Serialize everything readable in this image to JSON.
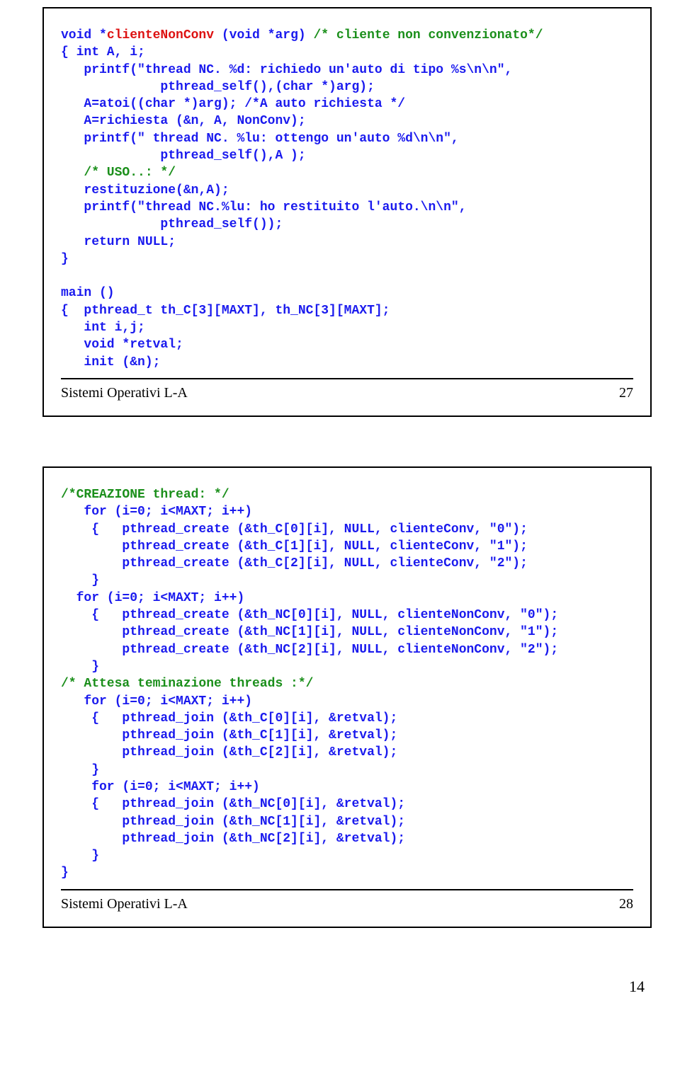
{
  "slide1": {
    "l1a": "void *",
    "l1b": "clienteNonConv",
    "l1c": " (void *arg)",
    "l1d": " /* cliente non convenzionato*/",
    "l2": "{ int A, i;",
    "l3": "   printf(\"thread NC. %d: richiedo un'auto di tipo %s\\n\\n\",",
    "l4": "             pthread_self(),(char *)arg);",
    "l5": "   A=atoi((char *)arg); /*A auto richiesta */",
    "l6": "   A=richiesta (&n, A, NonConv);",
    "l7": "   printf(\" thread NC. %lu: ottengo un'auto %d\\n\\n\",",
    "l8": "             pthread_self(),A );",
    "l9": "   /* USO..: */",
    "l10": "   restituzione(&n,A);",
    "l11": "   printf(\"thread NC.%lu: ho restituito l'auto.\\n\\n\",",
    "l12": "             pthread_self());",
    "l13": "   return NULL;",
    "l14": "}",
    "l15": "",
    "l16": "main ()",
    "l17": "{  pthread_t th_C[3][MAXT], th_NC[3][MAXT];",
    "l18": "   int i,j;",
    "l19": "   void *retval;",
    "l20": "   init (&n);",
    "footer_left": "Sistemi Operativi L-A",
    "footer_right": "27"
  },
  "slide2": {
    "l1": "/*CREAZIONE thread: */",
    "l2": "   for (i=0; i<MAXT; i++)",
    "l3": "    {   pthread_create (&th_C[0][i], NULL, clienteConv, \"0\");",
    "l4": "        pthread_create (&th_C[1][i], NULL, clienteConv, \"1\");",
    "l5": "        pthread_create (&th_C[2][i], NULL, clienteConv, \"2\");",
    "l6": "    }",
    "l7": "  for (i=0; i<MAXT; i++)",
    "l8": "    {   pthread_create (&th_NC[0][i], NULL, clienteNonConv, \"0\");",
    "l9": "        pthread_create (&th_NC[1][i], NULL, clienteNonConv, \"1\");",
    "l10": "        pthread_create (&th_NC[2][i], NULL, clienteNonConv, \"2\");",
    "l11": "    }",
    "l12": "/* Attesa teminazione threads :*/",
    "l13": "   for (i=0; i<MAXT; i++)",
    "l14": "    {   pthread_join (&th_C[0][i], &retval);",
    "l15": "        pthread_join (&th_C[1][i], &retval);",
    "l16": "        pthread_join (&th_C[2][i], &retval);",
    "l17": "    }",
    "l18": "    for (i=0; i<MAXT; i++)",
    "l19": "    {   pthread_join (&th_NC[0][i], &retval);",
    "l20": "        pthread_join (&th_NC[1][i], &retval);",
    "l21": "        pthread_join (&th_NC[2][i], &retval);",
    "l22": "    }",
    "l23": "}",
    "footer_left": "Sistemi Operativi L-A",
    "footer_right": "28"
  },
  "page_number": "14"
}
